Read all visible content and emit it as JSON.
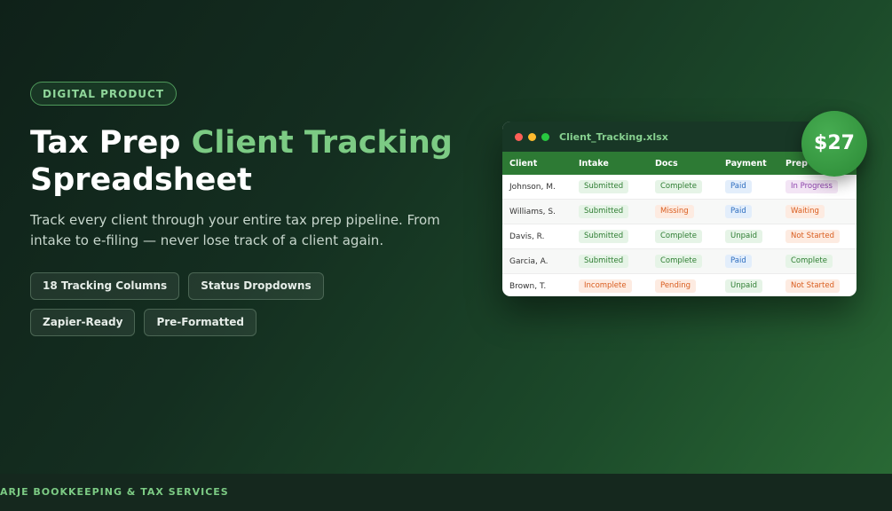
{
  "badge": "DIGITAL PRODUCT",
  "headline": {
    "part1": "Tax Prep ",
    "accent": "Client Tracking",
    "part2": "Spreadsheet"
  },
  "subtitle": "Track every client through your entire tax prep pipeline. From intake to e-filing — never lose track of a client again.",
  "features": [
    "18 Tracking Columns",
    "Status Dropdowns",
    "Zapier-Ready",
    "Pre-Formatted"
  ],
  "sheet": {
    "filename": "Client_Tracking.xlsx",
    "columns": [
      "Client",
      "Intake",
      "Docs",
      "Payment",
      "Prep"
    ],
    "rows": [
      {
        "client": "Johnson, M.",
        "intake": "Submitted",
        "docs": "Complete",
        "payment": "Paid",
        "prep": "In Progress"
      },
      {
        "client": "Williams, S.",
        "intake": "Submitted",
        "docs": "Missing",
        "payment": "Paid",
        "prep": "Waiting"
      },
      {
        "client": "Davis, R.",
        "intake": "Submitted",
        "docs": "Complete",
        "payment": "Unpaid",
        "prep": "Not Started"
      },
      {
        "client": "Garcia, A.",
        "intake": "Submitted",
        "docs": "Complete",
        "payment": "Paid",
        "prep": "Complete"
      },
      {
        "client": "Brown, T.",
        "intake": "Incomplete",
        "docs": "Pending",
        "payment": "Unpaid",
        "prep": "Not Started"
      }
    ]
  },
  "price": "$27",
  "footer": "ARJE BOOKKEEPING & TAX SERVICES",
  "colors": {
    "accent_green": "#7ccb84",
    "header_green": "#2d7a34",
    "window_close": "#ff5f57",
    "window_minimize": "#febc2e",
    "window_maximize": "#28c840"
  }
}
